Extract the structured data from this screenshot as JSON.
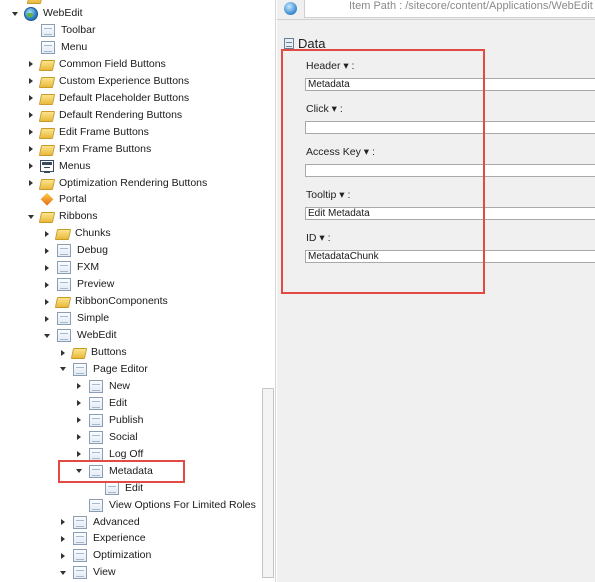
{
  "tree": {
    "rows": [
      {
        "label": "WebEdit",
        "indent": 0,
        "arrow": "down",
        "icon": "globe"
      },
      {
        "label": "Toolbar",
        "indent": 1,
        "arrow": "none",
        "icon": "doc"
      },
      {
        "label": "Menu",
        "indent": 1,
        "arrow": "none",
        "icon": "doc"
      },
      {
        "label": "Common Field Buttons",
        "indent": 1,
        "arrow": "right",
        "icon": "folder"
      },
      {
        "label": "Custom Experience Buttons",
        "indent": 1,
        "arrow": "right",
        "icon": "folder"
      },
      {
        "label": "Default Placeholder Buttons",
        "indent": 1,
        "arrow": "right",
        "icon": "folder"
      },
      {
        "label": "Default Rendering Buttons",
        "indent": 1,
        "arrow": "right",
        "icon": "folder"
      },
      {
        "label": "Edit Frame Buttons",
        "indent": 1,
        "arrow": "right",
        "icon": "folder"
      },
      {
        "label": "Fxm Frame Buttons",
        "indent": 1,
        "arrow": "right",
        "icon": "folder"
      },
      {
        "label": "Menus",
        "indent": 1,
        "arrow": "right",
        "icon": "menus"
      },
      {
        "label": "Optimization Rendering Buttons",
        "indent": 1,
        "arrow": "right",
        "icon": "folder"
      },
      {
        "label": "Portal",
        "indent": 1,
        "arrow": "none",
        "icon": "portal"
      },
      {
        "label": "Ribbons",
        "indent": 1,
        "arrow": "down",
        "icon": "folder"
      },
      {
        "label": "Chunks",
        "indent": 2,
        "arrow": "right",
        "icon": "folder"
      },
      {
        "label": "Debug",
        "indent": 2,
        "arrow": "right",
        "icon": "doc"
      },
      {
        "label": "FXM",
        "indent": 2,
        "arrow": "right",
        "icon": "doc"
      },
      {
        "label": "Preview",
        "indent": 2,
        "arrow": "right",
        "icon": "doc"
      },
      {
        "label": "RibbonComponents",
        "indent": 2,
        "arrow": "right",
        "icon": "folder"
      },
      {
        "label": "Simple",
        "indent": 2,
        "arrow": "right",
        "icon": "doc"
      },
      {
        "label": "WebEdit",
        "indent": 2,
        "arrow": "down",
        "icon": "doc"
      },
      {
        "label": "Buttons",
        "indent": 3,
        "arrow": "right",
        "icon": "folder"
      },
      {
        "label": "Page Editor",
        "indent": 3,
        "arrow": "down",
        "icon": "doc"
      },
      {
        "label": "New",
        "indent": 4,
        "arrow": "right",
        "icon": "doc"
      },
      {
        "label": "Edit",
        "indent": 4,
        "arrow": "right",
        "icon": "doc"
      },
      {
        "label": "Publish",
        "indent": 4,
        "arrow": "right",
        "icon": "doc"
      },
      {
        "label": "Social",
        "indent": 4,
        "arrow": "right",
        "icon": "doc"
      },
      {
        "label": "Log Off",
        "indent": 4,
        "arrow": "right",
        "icon": "doc"
      },
      {
        "label": "Metadata",
        "indent": 4,
        "arrow": "down",
        "icon": "doc"
      },
      {
        "label": "Edit",
        "indent": 5,
        "arrow": "none",
        "icon": "doc"
      },
      {
        "label": "View Options For Limited Roles",
        "indent": 4,
        "arrow": "none",
        "icon": "doc"
      },
      {
        "label": "Advanced",
        "indent": 3,
        "arrow": "right",
        "icon": "doc"
      },
      {
        "label": "Experience",
        "indent": 3,
        "arrow": "right",
        "icon": "doc"
      },
      {
        "label": "Optimization",
        "indent": 3,
        "arrow": "right",
        "icon": "doc"
      },
      {
        "label": "View",
        "indent": 3,
        "arrow": "down",
        "icon": "doc"
      }
    ]
  },
  "header": {
    "item_path_text": "Item Path : /sitecore/content/Applications/WebEdit"
  },
  "section": {
    "title": "Data"
  },
  "fields": [
    {
      "label": "Header",
      "value": "Metadata"
    },
    {
      "label": "Click",
      "value": ""
    },
    {
      "label": "Access Key",
      "value": ""
    },
    {
      "label": "Tooltip",
      "value": "Edit Metadata"
    },
    {
      "label": "ID",
      "value": "MetadataChunk"
    }
  ],
  "field_suffix": "▾ :",
  "colors": {
    "highlight": "#e24a43",
    "link": "#3a78c3",
    "pane_bg": "#f0f0f0"
  }
}
